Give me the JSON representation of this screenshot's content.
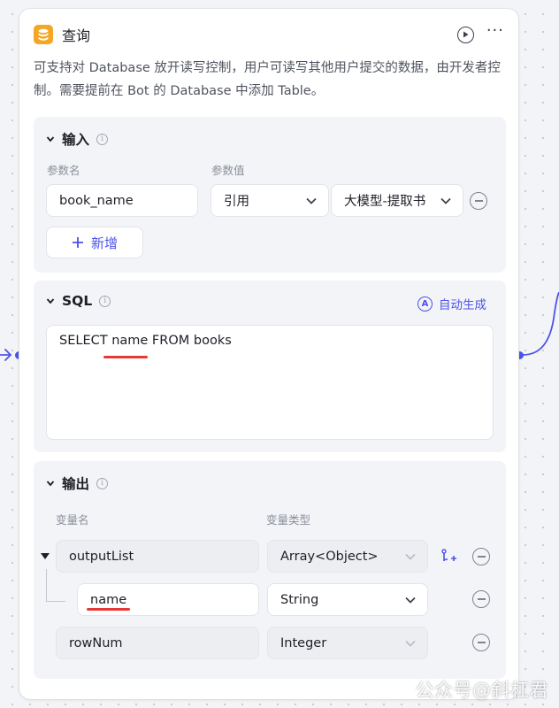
{
  "node": {
    "title": "查询",
    "description": "可支持对 Database 放开读写控制，用户可读写其他用户提交的数据，由开发者控制。需要提前在 Bot 的 Database 中添加 Table。"
  },
  "input_section": {
    "title": "输入",
    "param_name_label": "参数名",
    "param_value_label": "参数值",
    "params": [
      {
        "name": "book_name",
        "source": "引用",
        "value": "大模型-提取书"
      }
    ],
    "add_label": "新增"
  },
  "sql_section": {
    "title": "SQL",
    "auto_generate_label": "自动生成",
    "query": "SELECT name FROM books"
  },
  "output_section": {
    "title": "输出",
    "var_name_label": "变量名",
    "var_type_label": "变量类型",
    "vars": [
      {
        "name": "outputList",
        "type": "Array<Object>"
      },
      {
        "name": "name",
        "type": "String"
      },
      {
        "name": "rowNum",
        "type": "Integer"
      }
    ]
  },
  "watermark": "公众号@斜杠君",
  "colors": {
    "accent": "#4d53e8",
    "db_icon": "#f5a623",
    "highlight": "#e53935"
  }
}
